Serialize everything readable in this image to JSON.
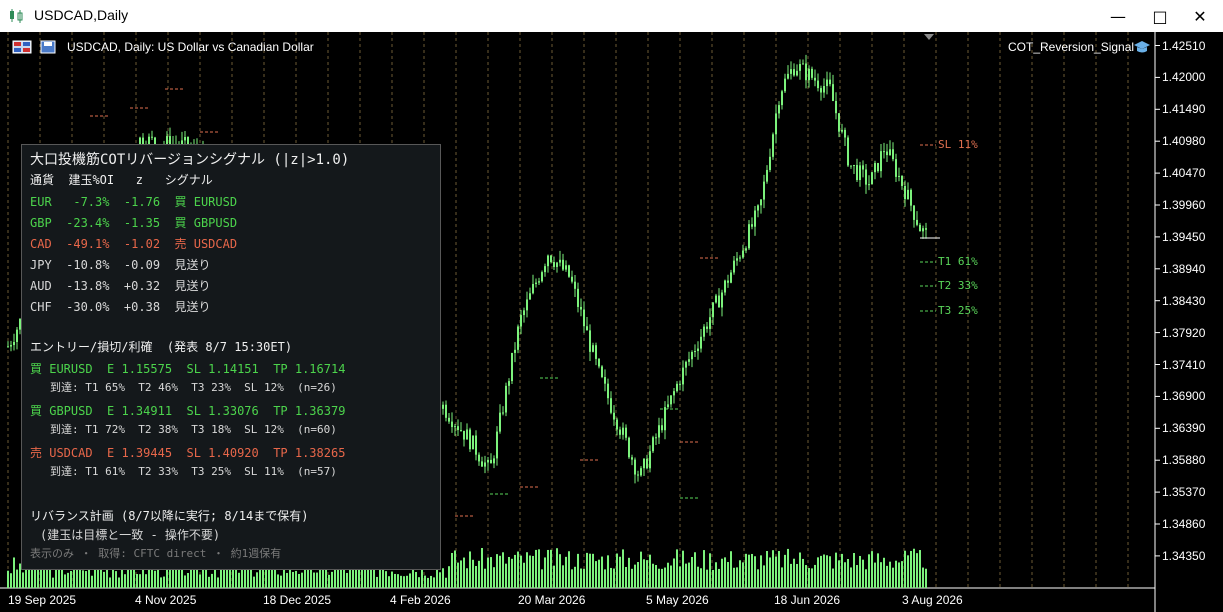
{
  "window": {
    "title": "USDCAD,Daily"
  },
  "chart_header": {
    "text": "USDCAD, Daily:  US Dollar vs Canadian Dollar",
    "indicator": "COT_Reversion_Signal"
  },
  "price_axis": [
    "1.42510",
    "1.42000",
    "1.41490",
    "1.40980",
    "1.40470",
    "1.39960",
    "1.39450",
    "1.38940",
    "1.38430",
    "1.37920",
    "1.37410",
    "1.36900",
    "1.36390",
    "1.35880",
    "1.35370",
    "1.34860",
    "1.34350"
  ],
  "date_axis": [
    "19 Sep 2025",
    "4 Nov 2025",
    "18 Dec 2025",
    "4 Feb 2026",
    "20 Mar 2026",
    "5 May 2026",
    "18 Jun 2026",
    "3 Aug 2026"
  ],
  "levels": [
    {
      "label": "SL 11%",
      "color": "#e07050"
    },
    {
      "label": "T1 61%",
      "color": "#5ad65a"
    },
    {
      "label": "T2 33%",
      "color": "#5ad65a"
    },
    {
      "label": "T3 25%",
      "color": "#5ad65a"
    }
  ],
  "panel": {
    "title": "大口投機筋COTリバージョンシグナル (|z|>1.0)",
    "header_row": "通貨  建玉%OI   z   シグナル",
    "rows": [
      {
        "text": "EUR   -7.3%  -1.76  買 EURUSD",
        "color": "#4cd44c"
      },
      {
        "text": "GBP  -23.4%  -1.35  買 GBPUSD",
        "color": "#4cd44c"
      },
      {
        "text": "CAD  -49.1%  -1.02  売 USDCAD",
        "color": "#e8674a"
      },
      {
        "text": "JPY  -10.8%  -0.09  見送り",
        "color": "#d8d8d8"
      },
      {
        "text": "AUD  -13.8%  +0.32  見送り",
        "color": "#d8d8d8"
      },
      {
        "text": "CHF  -30.0%  +0.38  見送り",
        "color": "#d8d8d8"
      }
    ],
    "entry_title": "エントリー/損切/利確  (発表 8/7 15:30ET)",
    "trades": [
      {
        "line": "買 EURUSD  E 1.15575  SL 1.14151  TP 1.16714",
        "stats": "到達: T1 65%  T2 46%  T3 23%  SL 12%  (n=26)",
        "color": "#4cd44c"
      },
      {
        "line": "買 GBPUSD  E 1.34911  SL 1.33076  TP 1.36379",
        "stats": "到達: T1 72%  T2 38%  T3 18%  SL 12%  (n=60)",
        "color": "#4cd44c"
      },
      {
        "line": "売 USDCAD  E 1.39445  SL 1.40920  TP 1.38265",
        "stats": "到達: T1 61%  T2 33%  T3 25%  SL 11%  (n=57)",
        "color": "#e8674a"
      }
    ],
    "rebalance_title": "リバランス計画 (8/7以降に実行; 8/14まで保有)",
    "rebalance_note": "(建玉は目標と一致 - 操作不要)",
    "footer": "表示のみ ・ 取得: CFTC direct ・ 約1週保有"
  },
  "colors": {
    "candle": "#7cf27c",
    "grid": "#6b5a35",
    "level_red": "#e07050",
    "level_green": "#5ad65a"
  }
}
